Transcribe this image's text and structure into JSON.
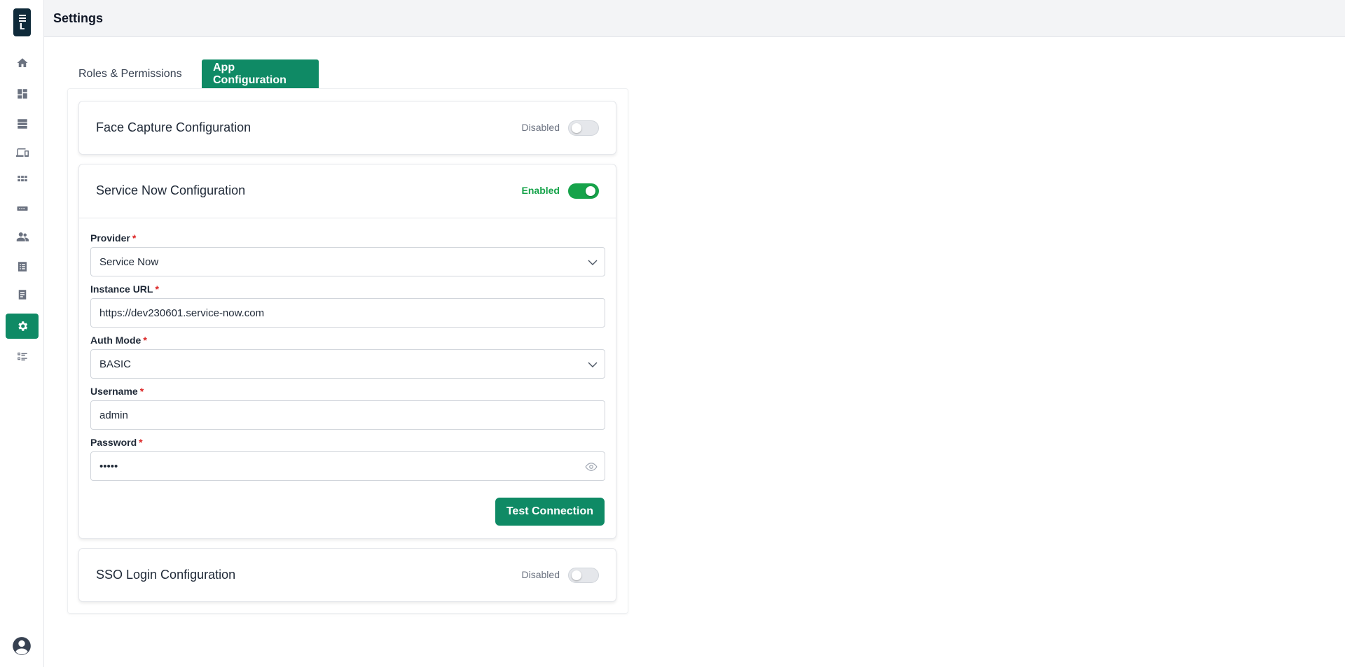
{
  "header": {
    "title": "Settings"
  },
  "sidebar": {
    "items": [
      {
        "icon": "home-icon"
      },
      {
        "icon": "dashboard-icon"
      },
      {
        "icon": "server-icon"
      },
      {
        "icon": "devices-icon"
      },
      {
        "icon": "apps-grid-icon"
      },
      {
        "icon": "sim-card-icon"
      },
      {
        "icon": "users-icon"
      },
      {
        "icon": "list-icon"
      },
      {
        "icon": "document-icon"
      },
      {
        "icon": "gear-icon",
        "active": true
      },
      {
        "icon": "checklist-icon"
      }
    ],
    "profile_icon": "user-circle-icon"
  },
  "tabs": [
    {
      "label": "Roles & Permissions",
      "active": false
    },
    {
      "label": "App Configuration",
      "active": true
    }
  ],
  "cards": {
    "face_capture": {
      "title": "Face Capture Configuration",
      "status": "Disabled",
      "enabled": false
    },
    "service_now": {
      "title": "Service Now Configuration",
      "status": "Enabled",
      "enabled": true,
      "fields": {
        "provider": {
          "label": "Provider",
          "required": "*",
          "value": "Service Now"
        },
        "instance_url": {
          "label": "Instance URL",
          "required": "*",
          "value": "https://dev230601.service-now.com"
        },
        "auth_mode": {
          "label": "Auth Mode",
          "required": "*",
          "value": "BASIC"
        },
        "username": {
          "label": "Username",
          "required": "*",
          "value": "admin"
        },
        "password": {
          "label": "Password",
          "required": "*",
          "value": "•••••"
        }
      },
      "test_button": "Test Connection"
    },
    "sso_login": {
      "title": "SSO Login Configuration",
      "status": "Disabled",
      "enabled": false
    }
  },
  "colors": {
    "accent": "#0f8a65",
    "enabled": "#16a34a",
    "required": "#dc2626"
  }
}
